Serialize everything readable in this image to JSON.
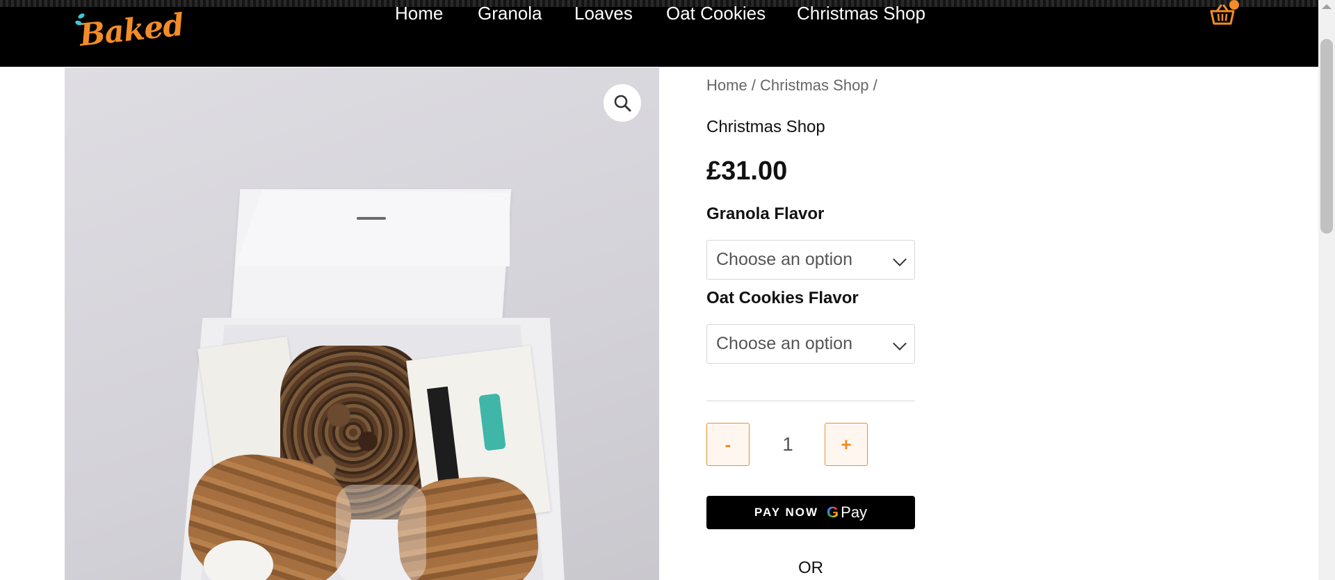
{
  "header": {
    "logo_text": "Baked",
    "nav": [
      {
        "label": "Home"
      },
      {
        "label": "Granola"
      },
      {
        "label": "Loaves"
      },
      {
        "label": "Oat Cookies"
      },
      {
        "label": "Christmas Shop"
      }
    ],
    "cart_icon": "basket-icon",
    "colors": {
      "background": "#000000",
      "accent": "#f28c28",
      "logo_leaf": "#3fc6d8"
    }
  },
  "gallery": {
    "zoom_icon": "magnifier-icon"
  },
  "product": {
    "breadcrumb": {
      "home": "Home",
      "sep1": " / ",
      "category": "Christmas Shop",
      "sep2": " /"
    },
    "category": "Christmas Shop",
    "price": "£31.00",
    "granola_flavor_label": "Granola Flavor",
    "granola_flavor_value": "Choose an option",
    "oat_cookies_flavor_label": "Oat Cookies Flavor",
    "oat_cookies_flavor_value": "Choose an option",
    "quantity": {
      "minus": "-",
      "value": "1",
      "plus": "+"
    },
    "pay_button": {
      "text": "PAY NOW",
      "g": "G",
      "pay": "Pay"
    },
    "or_text": "OR"
  }
}
